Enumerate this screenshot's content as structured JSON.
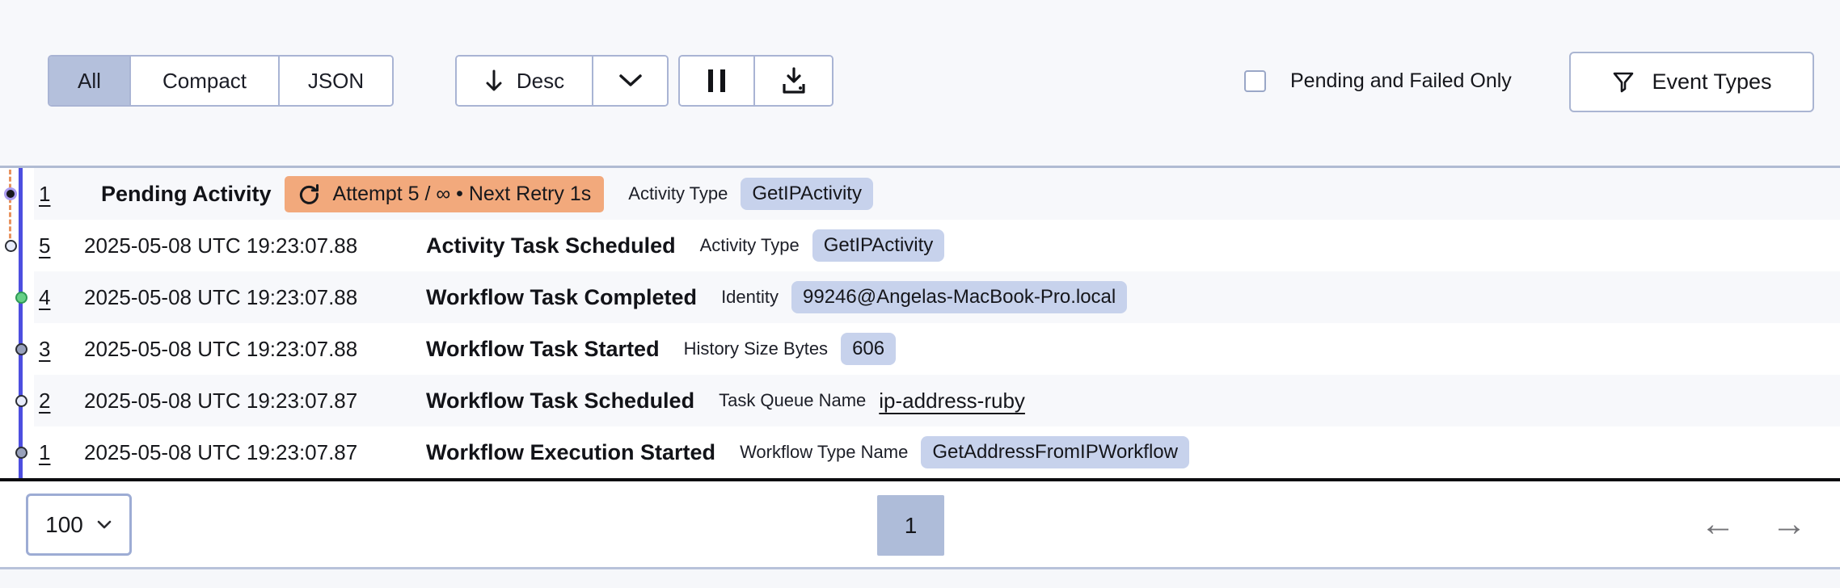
{
  "toolbar": {
    "view_tabs": [
      {
        "label": "All",
        "selected": true
      },
      {
        "label": "Compact",
        "selected": false
      },
      {
        "label": "JSON",
        "selected": false
      }
    ],
    "sort_label": "Desc",
    "pending_failed_label": "Pending and Failed Only",
    "pending_failed_checked": false,
    "event_types_label": "Event Types"
  },
  "events": [
    {
      "id": "1",
      "time": "",
      "title": "Pending Activity",
      "badge": "Attempt 5 / ∞ • Next Retry 1s",
      "attr_label": "Activity Type",
      "attr_value": "GetIPActivity",
      "attr_kind": "chip",
      "dot": "pending",
      "pending": true
    },
    {
      "id": "5",
      "time": "2025-05-08 UTC 19:23:07.88",
      "title": "Activity Task Scheduled",
      "attr_label": "Activity Type",
      "attr_value": "GetIPActivity",
      "attr_kind": "chip",
      "dot": "hollow",
      "pending": false
    },
    {
      "id": "4",
      "time": "2025-05-08 UTC 19:23:07.88",
      "title": "Workflow Task Completed",
      "attr_label": "Identity",
      "attr_value": "99246@Angelas-MacBook-Pro.local",
      "attr_kind": "chip",
      "dot": "green",
      "pending": false
    },
    {
      "id": "3",
      "time": "2025-05-08 UTC 19:23:07.88",
      "title": "Workflow Task Started",
      "attr_label": "History Size Bytes",
      "attr_value": "606",
      "attr_kind": "chip",
      "dot": "gray",
      "pending": false
    },
    {
      "id": "2",
      "time": "2025-05-08 UTC 19:23:07.87",
      "title": "Workflow Task Scheduled",
      "attr_label": "Task Queue Name",
      "attr_value": "ip-address-ruby",
      "attr_kind": "link",
      "dot": "hollow",
      "pending": false
    },
    {
      "id": "1",
      "time": "2025-05-08 UTC 19:23:07.87",
      "title": "Workflow Execution Started",
      "attr_label": "Workflow Type Name",
      "attr_value": "GetAddressFromIPWorkflow",
      "attr_kind": "chip",
      "dot": "gray",
      "pending": false
    }
  ],
  "pagination": {
    "page_size": "100",
    "current_page": "1",
    "prev_arrow": "←",
    "next_arrow": "→"
  },
  "colors": {
    "chip_bg": "#c7d2ec",
    "pending_badge_bg": "#f2a97c",
    "selected_tab_bg": "#b4c0dc",
    "current_page_bg": "#aebcd9",
    "timeline_line": "#4d4ee0",
    "retry_dash": "#e8935e",
    "dot_green": "#66d086",
    "dot_gray": "#98a1bb",
    "dot_hollow": "#e8ecfa",
    "dot_pending_ring": "#ab9df0",
    "toolbar_bg": "#f7f8fb"
  }
}
